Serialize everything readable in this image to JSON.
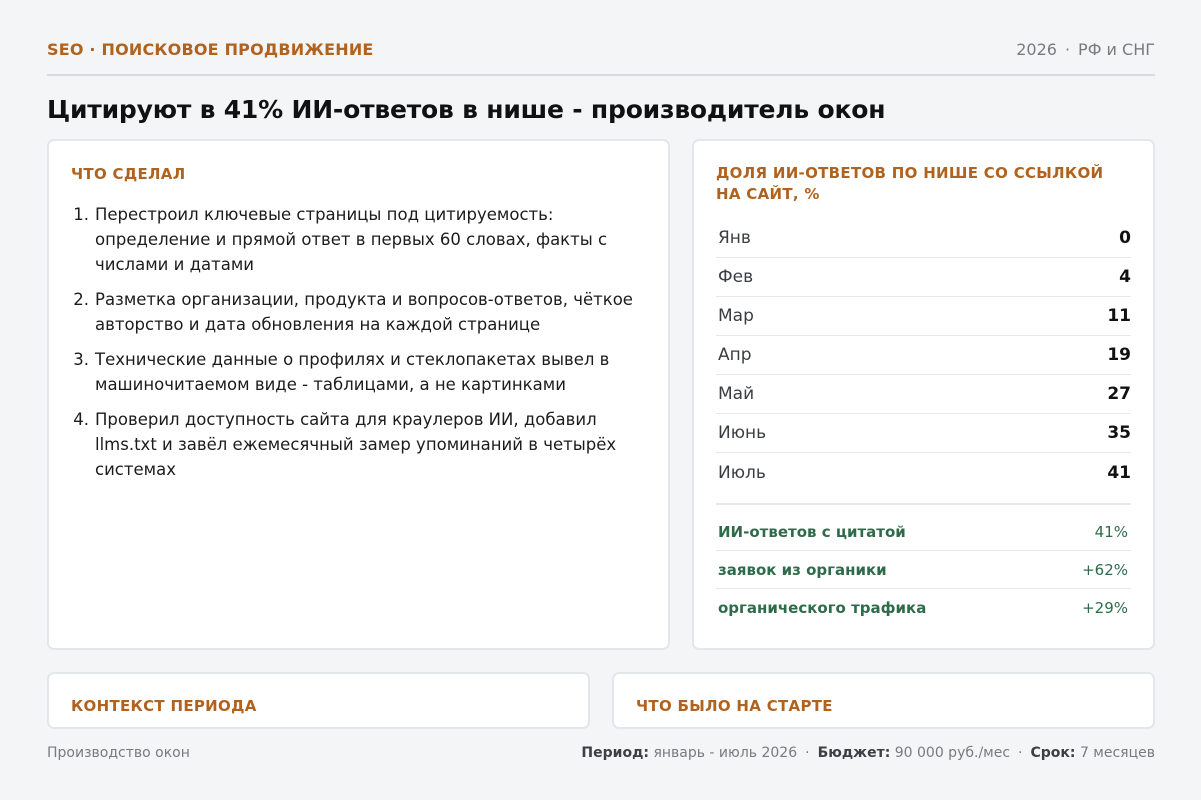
{
  "header": {
    "eyebrow": "SEO · ПОИСКОВОЕ ПРОДВИЖЕНИЕ",
    "year": "2026",
    "region": "РФ и СНГ",
    "separator": "·"
  },
  "title": "Цитируют в 41% ИИ-ответов в нише - производитель окон",
  "did": {
    "title": "ЧТО СДЕЛАЛ",
    "steps": [
      {
        "num": "1.",
        "text": "Перестроил ключевые страницы под цитируемость: определение и прямой ответ в первых 60 словах, факты с числами и датами"
      },
      {
        "num": "2.",
        "text": "Разметка организации, продукта и вопросов-ответов, чёткое авторство и дата обновления на каждой странице"
      },
      {
        "num": "3.",
        "text": "Технические данные о профилях и стеклопакетах вывел в машиночитаемом виде - таблицами, а не картинками"
      },
      {
        "num": "4.",
        "text": "Проверил доступность сайта для краулеров ИИ, добавил llms.txt и завёл ежемесячный замер упоминаний в четырёх системах"
      }
    ]
  },
  "chart": {
    "title": "ДОЛЯ ИИ-ОТВЕТОВ ПО НИШЕ СО ССЫЛКОЙ НА САЙТ, %"
  },
  "chart_data": {
    "type": "table",
    "title": "ДОЛЯ ИИ-ОТВЕТОВ ПО НИШЕ СО ССЫЛКОЙ НА САЙТ, %",
    "categories": [
      "Янв",
      "Фев",
      "Мар",
      "Апр",
      "Май",
      "Июнь",
      "Июль"
    ],
    "values": [
      0,
      4,
      11,
      19,
      27,
      35,
      41
    ]
  },
  "summary": [
    {
      "label": "ИИ-ответов с цитатой",
      "value": "41%"
    },
    {
      "label": "заявок из органики",
      "value": "+62%"
    },
    {
      "label": "органического трафика",
      "value": "+29%"
    }
  ],
  "context": {
    "title": "КОНТЕКСТ ПЕРИОДА"
  },
  "start": {
    "title": "ЧТО БЫЛО НА СТАРТЕ"
  },
  "footer": {
    "left": "Производство окон",
    "period_label": "Период:",
    "period": "январь - июль 2026",
    "budget_label": "Бюджет:",
    "budget": "90 000 руб./мес",
    "term_label": "Срок:",
    "term": "7 месяцев",
    "separator": "·"
  },
  "colors": {
    "accent": "#b0621f",
    "positive": "#2f6b4a",
    "background": "#f4f5f7"
  }
}
